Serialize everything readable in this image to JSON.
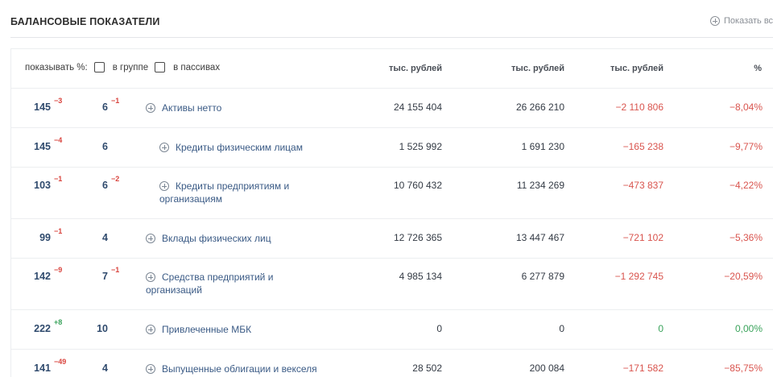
{
  "section": {
    "title": "БАЛАНСОВЫЕ ПОКАЗАТЕЛИ",
    "show_all_label": "Показать все"
  },
  "header": {
    "show_percent_label": "показывать %:",
    "in_group_label": "в группе",
    "in_liabilities_label": "в пассивах",
    "col1": "тыс. рублей",
    "col2": "тыс. рублей",
    "col3": "тыс. рублей",
    "col4": "%"
  },
  "rows": [
    {
      "rank1": "145",
      "d1": "−3",
      "d1_sign": "neg",
      "rank2": "6",
      "d2": "−1",
      "d2_sign": "neg",
      "name1": "Активы нетто",
      "name2": "",
      "v1": "24 155 404",
      "v2": "26 266 210",
      "v3": "−2 110 806",
      "v4": "−8,04%",
      "trend": "red"
    },
    {
      "rank1": "145",
      "d1": "−4",
      "d1_sign": "neg",
      "rank2": "6",
      "d2": "",
      "d2_sign": "neg",
      "name1": "Кредиты физическим лицам",
      "name2": "",
      "v1": "1 525 992",
      "v2": "1 691 230",
      "v3": "−165 238",
      "v4": "−9,77%",
      "trend": "red"
    },
    {
      "rank1": "103",
      "d1": "−1",
      "d1_sign": "neg",
      "rank2": "6",
      "d2": "−2",
      "d2_sign": "neg",
      "name1": "Кредиты предприятиям и",
      "name2": "организациям",
      "v1": "10 760 432",
      "v2": "11 234 269",
      "v3": "−473 837",
      "v4": "−4,22%",
      "trend": "red"
    },
    {
      "rank1": "99",
      "d1": "−1",
      "d1_sign": "neg",
      "rank2": "4",
      "d2": "",
      "d2_sign": "neg",
      "name1": "Вклады физических лиц",
      "name2": "",
      "v1": "12 726 365",
      "v2": "13 447 467",
      "v3": "−721 102",
      "v4": "−5,36%",
      "trend": "red"
    },
    {
      "rank1": "142",
      "d1": "−9",
      "d1_sign": "neg",
      "rank2": "7",
      "d2": "−1",
      "d2_sign": "neg",
      "name1": "Средства предприятий и",
      "name2": "организаций",
      "v1": "4 985 134",
      "v2": "6 277 879",
      "v3": "−1 292 745",
      "v4": "−20,59%",
      "trend": "red"
    },
    {
      "rank1": "222",
      "d1": "+8",
      "d1_sign": "pos",
      "rank2": "10",
      "d2": "",
      "d2_sign": "pos",
      "name1": "Привлеченные МБК",
      "name2": "",
      "v1": "0",
      "v2": "0",
      "v3": "0",
      "v4": "0,00%",
      "trend": "green"
    },
    {
      "rank1": "141",
      "d1": "−49",
      "d1_sign": "neg",
      "rank2": "4",
      "d2": "",
      "d2_sign": "neg",
      "name1": "Выпущенные облигации и векселя",
      "name2": "",
      "v1": "28 502",
      "v2": "200 084",
      "v3": "−171 582",
      "v4": "−85,75%",
      "trend": "red"
    }
  ]
}
